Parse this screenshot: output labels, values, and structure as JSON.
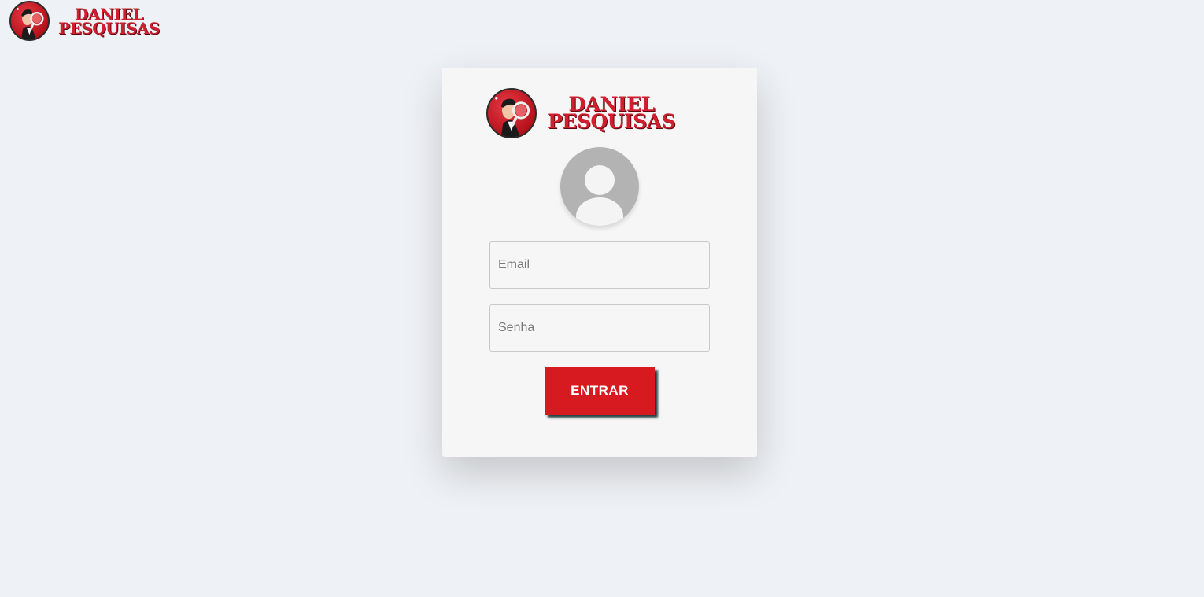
{
  "brand": {
    "name_line1": "DANIEL",
    "name_line2": "PESQUISAS",
    "colors": {
      "brand_red": "#d01f2e",
      "button_red": "#d71920",
      "background": "#eef1f5",
      "card": "#f6f6f6"
    }
  },
  "login": {
    "avatar_icon": "user-avatar-icon",
    "email_placeholder": "Email",
    "email_value": "",
    "password_placeholder": "Senha",
    "password_value": "",
    "submit_label": "ENTRAR"
  }
}
